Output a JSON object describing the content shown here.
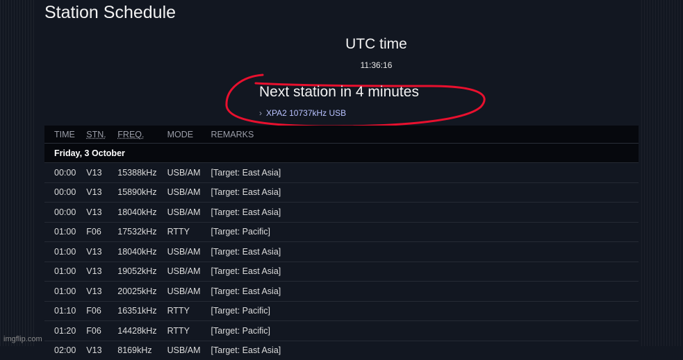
{
  "page": {
    "title": "Station Schedule"
  },
  "clock": {
    "label": "UTC time",
    "time": "11:36:16"
  },
  "next": {
    "title": "Next station in 4 minutes",
    "chevron": "›",
    "link": "XPA2 10737kHz USB"
  },
  "table": {
    "headers": [
      "TIME",
      "STN.",
      "FREQ.",
      "MODE",
      "REMARKS"
    ],
    "day": "Friday, 3 October",
    "rows": [
      {
        "time": "00:00",
        "stn": "V13",
        "freq": "15388kHz",
        "mode": "USB/AM",
        "remarks": "[Target: East Asia]"
      },
      {
        "time": "00:00",
        "stn": "V13",
        "freq": "15890kHz",
        "mode": "USB/AM",
        "remarks": "[Target: East Asia]"
      },
      {
        "time": "00:00",
        "stn": "V13",
        "freq": "18040kHz",
        "mode": "USB/AM",
        "remarks": "[Target: East Asia]"
      },
      {
        "time": "01:00",
        "stn": "F06",
        "freq": "17532kHz",
        "mode": "RTTY",
        "remarks": "[Target: Pacific]"
      },
      {
        "time": "01:00",
        "stn": "V13",
        "freq": "18040kHz",
        "mode": "USB/AM",
        "remarks": "[Target: East Asia]"
      },
      {
        "time": "01:00",
        "stn": "V13",
        "freq": "19052kHz",
        "mode": "USB/AM",
        "remarks": "[Target: East Asia]"
      },
      {
        "time": "01:00",
        "stn": "V13",
        "freq": "20025kHz",
        "mode": "USB/AM",
        "remarks": "[Target: East Asia]"
      },
      {
        "time": "01:10",
        "stn": "F06",
        "freq": "16351kHz",
        "mode": "RTTY",
        "remarks": "[Target: Pacific]"
      },
      {
        "time": "01:20",
        "stn": "F06",
        "freq": "14428kHz",
        "mode": "RTTY",
        "remarks": "[Target: Pacific]"
      },
      {
        "time": "02:00",
        "stn": "V13",
        "freq": "8169kHz",
        "mode": "USB/AM",
        "remarks": "[Target: East Asia]"
      }
    ]
  },
  "colors": {
    "v_station": "#4bd24b",
    "f_station": "#ff3b2f",
    "freq": "#f2e266",
    "annotation": "#e8102e"
  },
  "watermark": "imgflip.com"
}
